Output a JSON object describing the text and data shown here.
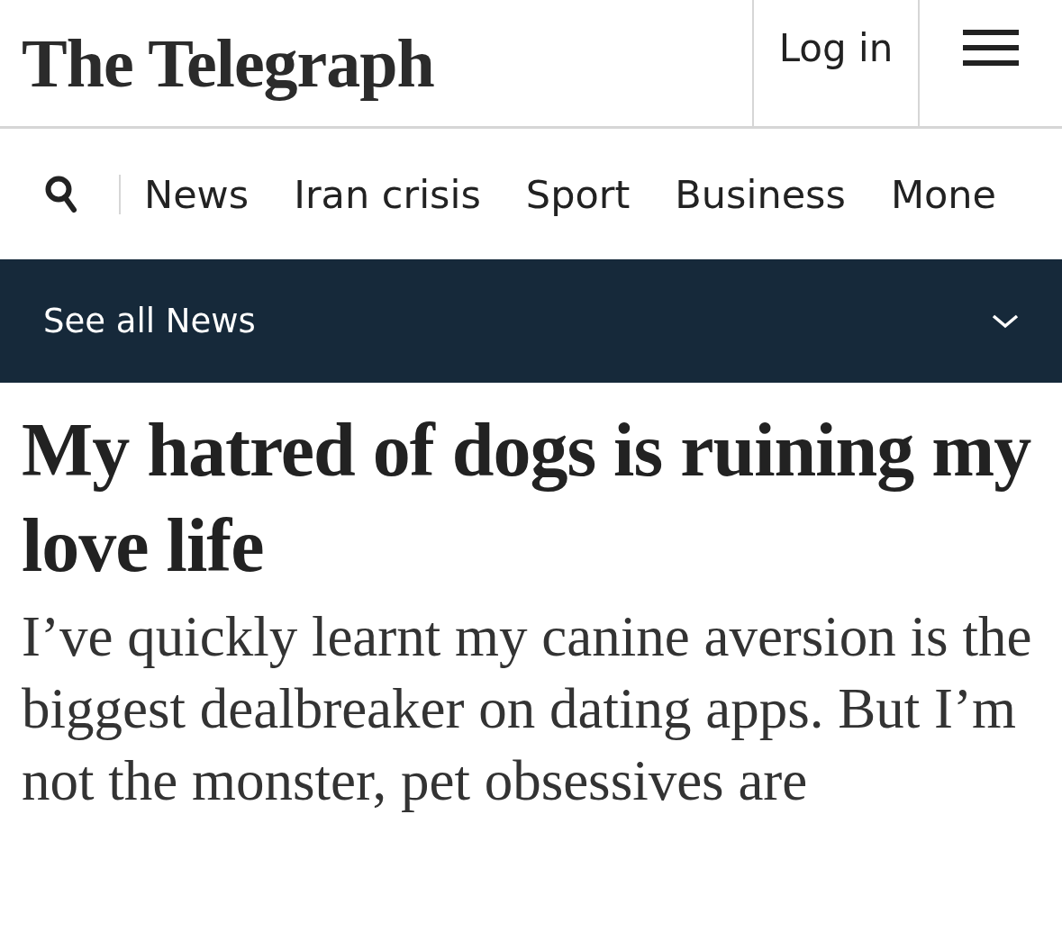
{
  "header": {
    "logo": "The Telegraph",
    "login": "Log in"
  },
  "nav": {
    "items": [
      {
        "label": "News"
      },
      {
        "label": "Iran crisis"
      },
      {
        "label": "Sport"
      },
      {
        "label": "Business"
      },
      {
        "label": "Mone"
      }
    ]
  },
  "section_bar": {
    "label": "See all News",
    "expanded": false
  },
  "article": {
    "headline": "My hatred of dogs is ruining my love life",
    "standfirst": "I’ve quickly learnt my canine aversion is the biggest dealbreaker on dating apps. But I’m not the monster, pet obsessives are"
  }
}
